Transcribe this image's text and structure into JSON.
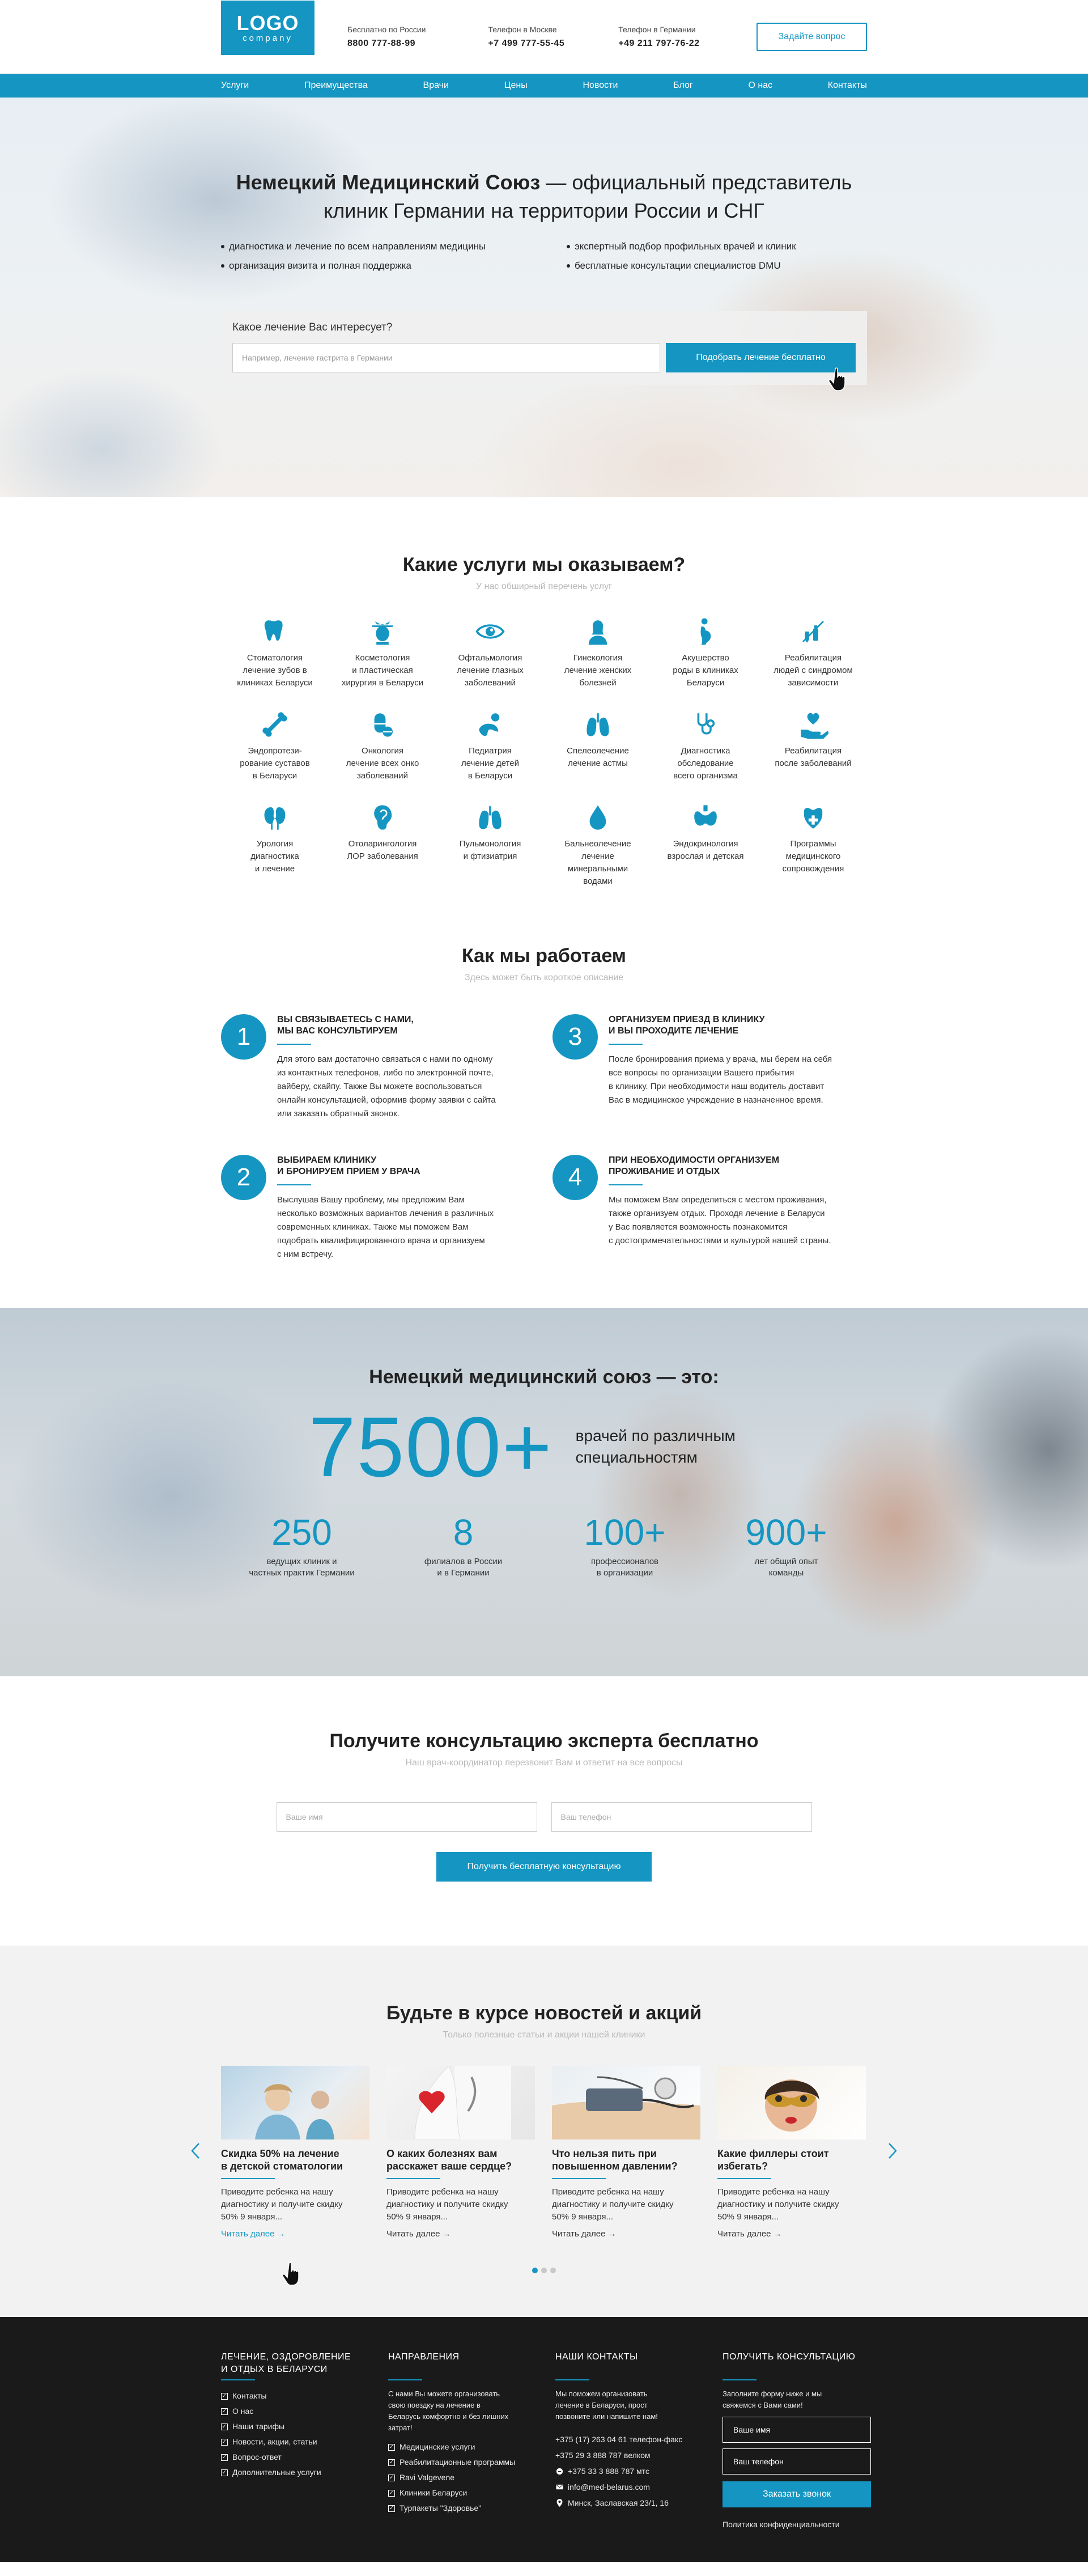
{
  "colors": {
    "accent": "#1596c2",
    "footer_bg": "#1a1a1a",
    "news_bg": "#f2f2f2"
  },
  "header": {
    "logo_line1": "LOGO",
    "logo_line2": "company",
    "contacts": [
      {
        "caption": "Бесплатно по России",
        "number": "8800 777-88-99"
      },
      {
        "caption": "Телефон в Москве",
        "number": "+7 499  777-55-45"
      },
      {
        "caption": "Телефон в Германии",
        "number": "+49 211 797-76-22"
      }
    ],
    "ask_button": "Задайте вопрос"
  },
  "nav": [
    "Услуги",
    "Преимущества",
    "Врачи",
    "Цены",
    "Новости",
    "Блог",
    "О нас",
    "Контакты"
  ],
  "hero": {
    "title_bold": "Немецкий Медицинский Союз",
    "title_rest": " — официальный представитель",
    "title_line2": "клиник Германии на территории России и СНГ",
    "bullets": [
      "диагностика и лечение по всем направлениям медицины",
      "экспертный подбор профильных врачей и клиник",
      "организация визита и полная поддержка",
      "бесплатные консультации специалистов DMU"
    ],
    "question": "Какое лечение Вас интересует?",
    "input_placeholder": "Например, лечение гастрита в Германии",
    "button": "Подобрать лечение бесплатно"
  },
  "services": {
    "title": "Какие услуги мы оказываем?",
    "subtitle": "У нас обширный перечень услуг",
    "items": [
      {
        "icon": "tooth-icon",
        "label": "Стоматология\nлечение зубов в\nклиниках Беларуси"
      },
      {
        "icon": "cosmetology-icon",
        "label": "Косметология\nи пластическая\nхирургия в Беларуси"
      },
      {
        "icon": "eye-icon",
        "label": "Офтальмология\nлечение глазных\nзаболеваний"
      },
      {
        "icon": "woman-icon",
        "label": "Гинекология\nлечение женских\nболезней"
      },
      {
        "icon": "pregnancy-icon",
        "label": "Акушерство\nроды в клиниках\nБеларуси"
      },
      {
        "icon": "rehab-icon",
        "label": "Реабилитация\nлюдей с синдромом\nзависимости"
      },
      {
        "icon": "bone-icon",
        "label": "Эндопротези-\nрование суставов\nв Беларуси"
      },
      {
        "icon": "pill-icon",
        "label": "Онкология\nлечение всех онко\nзаболеваний"
      },
      {
        "icon": "child-icon",
        "label": "Педиатрия\nлечение детей\nв Беларуси"
      },
      {
        "icon": "lungs-icon",
        "label": "Спелеолечение\nлечение астмы"
      },
      {
        "icon": "stethoscope-icon",
        "label": "Диагностика\nобследование\nвсего организма"
      },
      {
        "icon": "heart-hand-icon",
        "label": "Реабилитация\nпосле заболеваний"
      },
      {
        "icon": "kidneys-icon",
        "label": "Урология\nдиагностика\nи лечение"
      },
      {
        "icon": "ear-icon",
        "label": "Отоларингология\nЛОР заболевания"
      },
      {
        "icon": "lungs-icon",
        "label": "Пульмонология\nи фтизиатрия"
      },
      {
        "icon": "drop-icon",
        "label": "Бальнеолечение\nлечение\nминеральными\nводами"
      },
      {
        "icon": "thyroid-icon",
        "label": "Эндокринология\nвзрослая и детская"
      },
      {
        "icon": "medkit-icon",
        "label": "Программы\nмедицинского\nсопровождения"
      }
    ]
  },
  "how": {
    "title": "Как мы работаем",
    "subtitle": "Здесь может быть короткое описание",
    "steps": [
      {
        "num": "1",
        "title": "ВЫ СВЯЗЫВАЕТЕСЬ С НАМИ,\nМЫ ВАС КОНСУЛЬТИРУЕМ",
        "text": "Для этого вам достаточно связаться с нами по одному\nиз контактных телефонов, либо по электронной почте,\nвайберу, скайпу. Также Вы можете воспользоваться\nонлайн консультацией, оформив форму заявки с сайта\nили заказать обратный звонок."
      },
      {
        "num": "3",
        "title": "ОРГАНИЗУЕМ ПРИЕЗД В КЛИНИКУ\nИ ВЫ ПРОХОДИТЕ ЛЕЧЕНИЕ",
        "text": "После бронирования приема у врача, мы берем на себя\nвсе вопросы по организации Вашего прибытия\nв клинику. При необходимости наш водитель доставит\nВас в медицинское учреждение в назначенное время."
      },
      {
        "num": "2",
        "title": "ВЫБИРАЕМ КЛИНИКУ\nИ БРОНИРУЕМ ПРИЕМ У ВРАЧА",
        "text": "Выслушав Вашу проблему, мы предложим Вам\nнесколько возможных вариантов лечения в различных\nсовременных клиниках. Также мы поможем Вам\nподобрать квалифицированного врача и организуем\nс ним встречу."
      },
      {
        "num": "4",
        "title": "ПРИ НЕОБХОДИМОСТИ ОРГАНИЗУЕМ\nПРОЖИВАНИЕ И ОТДЫХ",
        "text": "Мы поможем Вам определиться с местом проживания,\nтакже организуем отдых. Проходя лечение в Беларуси\nу Вас появляется возможность познакомится\nс достопримечательностями и культурой нашей страны."
      }
    ]
  },
  "stats": {
    "title": "Немецкий медицинский союз — это:",
    "big_number": "7500+",
    "big_desc": "врачей по различным\nспециальностям",
    "items": [
      {
        "num": "250",
        "desc": "ведущих клиник и\nчастных практик Германии"
      },
      {
        "num": "8",
        "desc": "филиалов в России\nи в Германии"
      },
      {
        "num": "100+",
        "desc": "профессионалов\nв организации"
      },
      {
        "num": "900+",
        "desc": "лет общий опыт\nкоманды"
      }
    ]
  },
  "consult": {
    "title": "Получите консультацию эксперта бесплатно",
    "subtitle": "Наш врач-координатор  перезвонит Вам и ответит на все вопросы",
    "name_placeholder": "Ваше имя",
    "phone_placeholder": "Ваш телефон",
    "button": "Получить бесплатную консультацию"
  },
  "news": {
    "title": "Будьте в курсе новостей и акций",
    "subtitle": "Только полезные статьи и акции нашей клиники",
    "cards": [
      {
        "title": "Скидка 50% на лечение\nв детской стоматологии",
        "text": "Приводите ребенка на нашу\nдиагностику и получите скидку\n50% 9 января...",
        "more": "Читать далее →"
      },
      {
        "title": "О каких болезнях вам\nрасскажет ваше сердце?",
        "text": "Приводите ребенка на нашу\nдиагностику и получите скидку\n50% 9 января...",
        "more": "Читать далее →"
      },
      {
        "title": "Что нельзя пить при\nповышенном давлении?",
        "text": "Приводите ребенка на нашу\nдиагностику и получите скидку\n50% 9 января...",
        "more": "Читать далее →"
      },
      {
        "title": "Какие филлеры стоит\nизбегать?",
        "text": "Приводите ребенка на нашу\nдиагностику и получите скидку\n50% 9 января...",
        "more": "Читать далее →"
      }
    ]
  },
  "footer": {
    "col1": {
      "title": "ЛЕЧЕНИЕ, ОЗДОРОВЛЕНИЕ\nИ ОТДЫХ В БЕЛАРУСИ",
      "links": [
        "Контакты",
        "О нас",
        "Наши тарифы",
        "Новости, акции, статьи",
        "Вопрос-ответ",
        "Дополнительные услуги"
      ]
    },
    "col2": {
      "title": "НАПРАВЛЕНИЯ",
      "text": "С нами Вы можете организовать\nсвою поездку на лечение в\nБеларусь комфортно и без лишних\nзатрат!",
      "links": [
        "Медицинские услуги",
        "Реабилитационные программы",
        "Ravi Valgevene",
        "Клиники Беларуси",
        "Турпакеты \"Здоровье\""
      ]
    },
    "col3": {
      "title": "НАШИ КОНТАКТЫ",
      "text": "Мы поможем организовать\nлечение в Беларуси, прост\nпозвоните или напишите нам!",
      "lines": [
        {
          "icon": "",
          "text": "+375 (17) 263 04 61 телефон-факс"
        },
        {
          "icon": "",
          "text": "+375 29 3 888 787 велком"
        },
        {
          "icon": "messenger-icon",
          "text": "+375 33 3 888 787 мтс"
        },
        {
          "icon": "mail-icon",
          "text": "info@med-belarus.com"
        },
        {
          "icon": "pin-icon",
          "text": "Минск, Заславская 23/1, 16"
        }
      ]
    },
    "col4": {
      "title": "ПОЛУЧИТЬ КОНСУЛЬТАЦИЮ",
      "text": "Заполните форму ниже и мы\nсвяжемся с Вами сами!",
      "name_placeholder": "Ваше имя",
      "phone_placeholder": "Ваш телефон",
      "button": "Заказать звонок",
      "policy": "Политика конфиденциальности"
    }
  }
}
